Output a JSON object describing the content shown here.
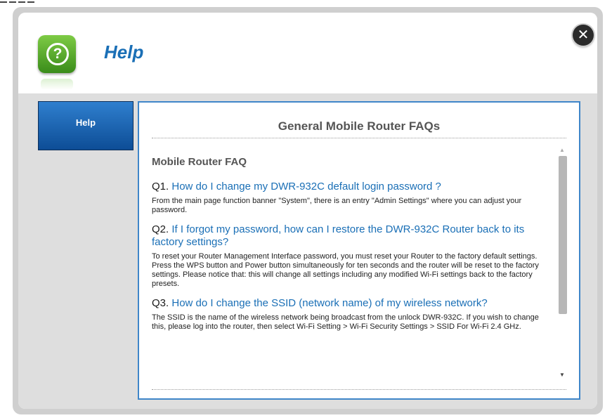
{
  "header": {
    "title": "Help",
    "icon": "question-icon",
    "close_icon": "close-icon",
    "close_glyph": "✕"
  },
  "sidebar": {
    "items": [
      {
        "label": "Help"
      }
    ]
  },
  "content": {
    "title": "General Mobile Router FAQs",
    "faq_heading": "Mobile Router FAQ",
    "faqs": [
      {
        "num": "Q1.",
        "question": "How do I change my DWR-932C default login password ?",
        "answer": "From the main page function banner \"System\", there is an entry \"Admin Settings\" where you can adjust your password."
      },
      {
        "num": "Q2.",
        "question": "If I forgot my password, how can I restore the DWR-932C Router back to its factory settings?",
        "answer": "To reset your Router Management Interface password, you must reset your Router to the factory default settings. Press the WPS button and Power button simultaneously for ten seconds and the router will be reset to the factory settings. Please notice that: this will change all settings including any modified Wi-Fi settings back to the factory presets."
      },
      {
        "num": "Q3.",
        "question": "How do I change the SSID (network name) of my wireless network?",
        "answer": "The SSID is the name of the wireless network being broadcast from the unlock DWR-932C. If you wish to change this, please log into the router, then select Wi-Fi Setting > Wi-Fi Security Settings > SSID For Wi-Fi 2.4 GHz."
      }
    ]
  },
  "colors": {
    "accent": "#1a6fb6",
    "tab_blue": "#1560b0",
    "icon_green": "#4fa52a",
    "panel_gray": "#dedede"
  }
}
